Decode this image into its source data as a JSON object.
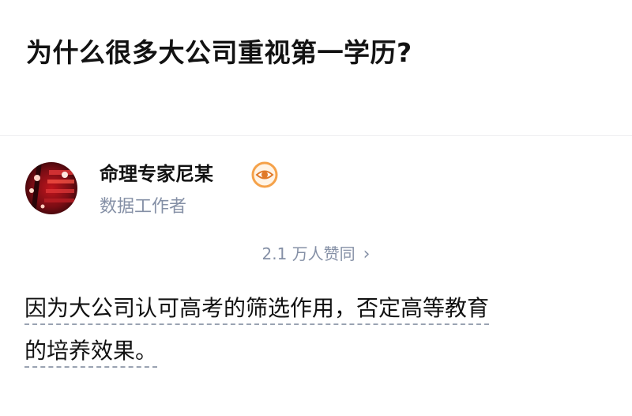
{
  "question": {
    "title": "为什么很多大公司重视第一学历?"
  },
  "author": {
    "name": "命理专家尼某",
    "headline": "数据工作者",
    "badge_icon": "eye-badge-icon",
    "badge_color": "#f5a24a"
  },
  "votes": {
    "text": "2.1 万人赞同",
    "chevron": "›"
  },
  "answer": {
    "line1": "因为大公司认可高考的筛选作用，否定高等教育",
    "line2": "的培养效果。"
  }
}
